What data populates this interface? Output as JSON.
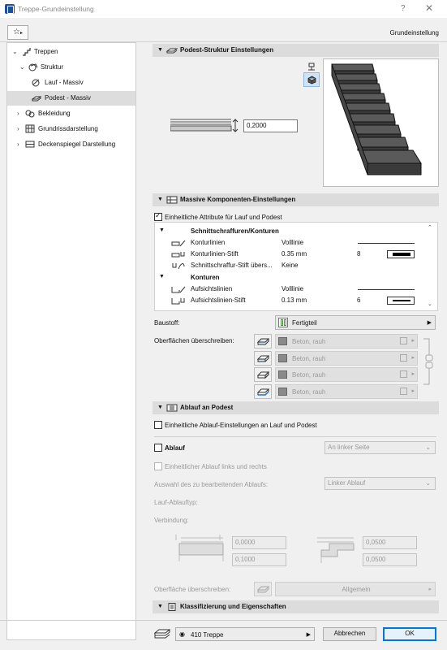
{
  "window": {
    "title": "Treppe-Grundeinstellung",
    "help": "?",
    "close": "✕"
  },
  "header": {
    "mode_label": "Grundeinstellung"
  },
  "tree": {
    "items": [
      {
        "label": "Treppen"
      },
      {
        "label": "Struktur"
      },
      {
        "label": "Lauf - Massiv"
      },
      {
        "label": "Podest - Massiv"
      },
      {
        "label": "Bekleidung"
      },
      {
        "label": "Grundrissdarstellung"
      },
      {
        "label": "Deckenspiegel Darstellung"
      }
    ]
  },
  "podest": {
    "title": "Podest-Struktur Einstellungen",
    "thickness": "0,2000"
  },
  "massive": {
    "title": "Massive Komponenten-Einstellungen",
    "uniform_label": "Einheitliche Attribute für Lauf und Podest",
    "groups": [
      {
        "label": "Schnittschraffuren/Konturen",
        "rows": [
          {
            "name": "Konturlinien",
            "value": "Volllinie",
            "extra": ""
          },
          {
            "name": "Konturlinien-Stift",
            "value": "0.35 mm",
            "extra": "8"
          },
          {
            "name": "Schnittschraffur-Stift übers...",
            "value": "Keine",
            "extra": ""
          }
        ]
      },
      {
        "label": "Konturen",
        "rows": [
          {
            "name": "Aufsichtslinien",
            "value": "Volllinie",
            "extra": ""
          },
          {
            "name": "Aufsichtslinien-Stift",
            "value": "0.13 mm",
            "extra": "6"
          }
        ]
      }
    ],
    "baustoff_label": "Baustoff:",
    "baustoff_value": "Fertigteil",
    "surfaces_label": "Oberflächen überschreiben:",
    "surfaces": [
      "Beton, rauh",
      "Beton, rauh",
      "Beton, rauh",
      "Beton, rauh"
    ]
  },
  "ablauf": {
    "title": "Ablauf an Podest",
    "uniform_label": "Einheitliche Ablauf-Einstellungen an Lauf und Podest",
    "ablauf_label": "Ablauf",
    "side_value": "An linker Seite",
    "lr_label": "Einheitlicher Ablauf links und rechts",
    "select_label": "Auswahl des zu bearbeitenden Ablaufs:",
    "select_value": "Linker Ablauf",
    "type_label": "Lauf-Ablauftyp:",
    "connection_label": "Verbindung:",
    "left_vals": [
      "0,0000",
      "0,1000"
    ],
    "right_vals": [
      "0,0500",
      "0,0500"
    ],
    "surface_label": "Oberfläche überschreiben:",
    "surface_value": "Allgemein"
  },
  "klass": {
    "title": "Klassifizierung und Eigenschaften"
  },
  "footer": {
    "layer": "410 Treppe",
    "cancel": "Abbrechen",
    "ok": "OK"
  }
}
